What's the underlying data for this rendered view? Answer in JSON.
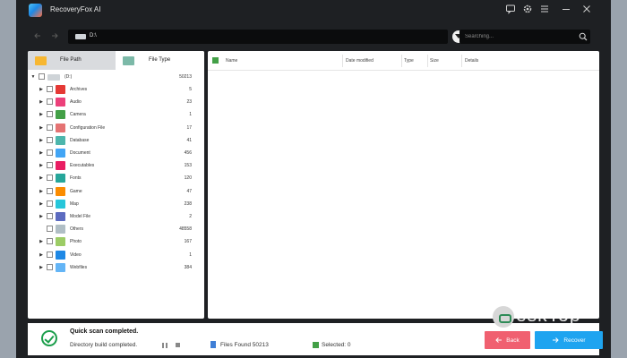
{
  "app": {
    "title": "RecoveryFox AI"
  },
  "titlebar": {
    "icons": [
      "chat-icon",
      "gear-icon",
      "menu-icon",
      "minimize-icon",
      "close-icon"
    ]
  },
  "toolbar": {
    "path": "D:\\",
    "search_placeholder": "Searching..."
  },
  "left_panel": {
    "tabs": [
      {
        "label": "File Path",
        "active": true
      },
      {
        "label": "File Type",
        "active": false
      }
    ],
    "root": {
      "label": "(D:)",
      "count": "50213"
    },
    "items": [
      {
        "label": "Archives",
        "count": "5",
        "color": "#e53935",
        "icon": "archive-icon",
        "expandable": true
      },
      {
        "label": "Audio",
        "count": "23",
        "color": "#ec407a",
        "icon": "audio-icon",
        "expandable": true
      },
      {
        "label": "Camera",
        "count": "1",
        "color": "#43a047",
        "icon": "camera-icon",
        "expandable": true
      },
      {
        "label": "Configuration File",
        "count": "17",
        "color": "#e57373",
        "icon": "config-icon",
        "expandable": true
      },
      {
        "label": "Database",
        "count": "41",
        "color": "#4db6ac",
        "icon": "database-icon",
        "expandable": true
      },
      {
        "label": "Document",
        "count": "456",
        "color": "#42a5f5",
        "icon": "document-icon",
        "expandable": true
      },
      {
        "label": "Executables",
        "count": "153",
        "color": "#e91e63",
        "icon": "executable-icon",
        "expandable": true
      },
      {
        "label": "Fonts",
        "count": "120",
        "color": "#26a69a",
        "icon": "font-icon",
        "expandable": true
      },
      {
        "label": "Game",
        "count": "47",
        "color": "#fb8c00",
        "icon": "game-icon",
        "expandable": true
      },
      {
        "label": "Map",
        "count": "238",
        "color": "#26c6da",
        "icon": "map-icon",
        "expandable": true
      },
      {
        "label": "Model File",
        "count": "2",
        "color": "#5c6bc0",
        "icon": "model-icon",
        "expandable": true
      },
      {
        "label": "Others",
        "count": "48558",
        "color": "#b0bec5",
        "icon": "others-icon",
        "expandable": false
      },
      {
        "label": "Photo",
        "count": "167",
        "color": "#9ccc65",
        "icon": "photo-icon",
        "expandable": true
      },
      {
        "label": "Video",
        "count": "1",
        "color": "#1e88e5",
        "icon": "video-icon",
        "expandable": true
      },
      {
        "label": "Webfiles",
        "count": "384",
        "color": "#64b5f6",
        "icon": "webfile-icon",
        "expandable": true
      }
    ]
  },
  "file_list": {
    "columns": [
      "Name",
      "Date modified",
      "Type",
      "Size",
      "Details"
    ]
  },
  "status": {
    "title": "Quick scan completed.",
    "subtitle": "Directory build completed.",
    "files_found_label": "Files Found",
    "files_found": "50213",
    "selected_label": "Selected:",
    "selected": "0",
    "back_label": "Back",
    "recover_label": "Recover"
  },
  "watermark": {
    "text": "eskTop"
  },
  "colors": {
    "back_button": "#f06070",
    "recover_button": "#1ea4f0",
    "check_green": "#43a047",
    "window_bg": "#1e2023"
  }
}
